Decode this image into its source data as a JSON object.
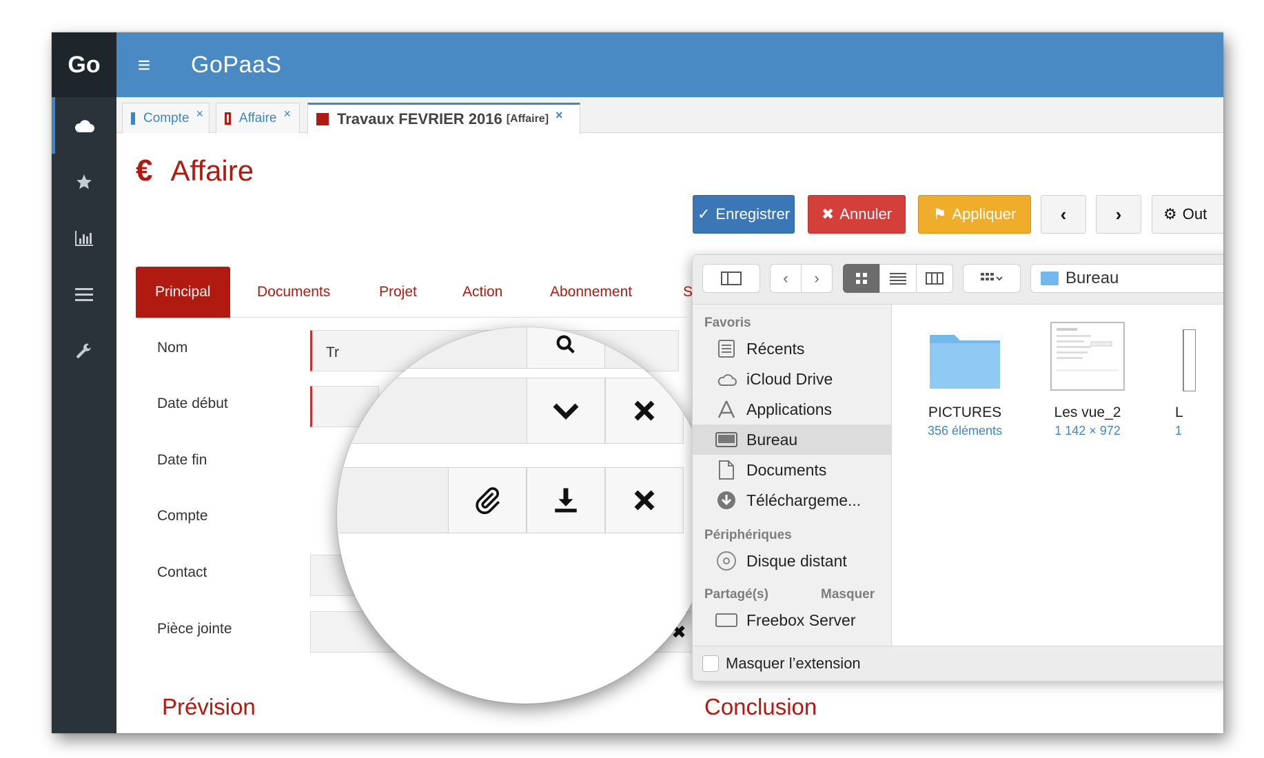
{
  "app": {
    "brand": "Go",
    "title": "GoPaaS",
    "sidebar_icons": [
      "cloud-icon",
      "star-icon",
      "bar-chart-icon",
      "list-icon",
      "wrench-icon"
    ]
  },
  "tabs": [
    {
      "label": "Compte",
      "close": "×"
    },
    {
      "label": "Affaire",
      "close": "×"
    },
    {
      "label": "Travaux FEVRIER 2016",
      "tag": "[Affaire]",
      "close": "×"
    }
  ],
  "page": {
    "euro": "€",
    "title": "Affaire"
  },
  "toolbar": {
    "save": "Enregistrer",
    "cancel": "Annuler",
    "apply": "Appliquer",
    "prev": "‹",
    "next": "›",
    "tools": "Out"
  },
  "form_tabs": [
    "Principal",
    "Documents",
    "Projet",
    "Action",
    "Abonnement",
    "S"
  ],
  "fields": {
    "nom": "Nom",
    "nom_value": "Tr",
    "date_debut": "Date début",
    "date_fin": "Date fin",
    "compte": "Compte",
    "contact": "Contact",
    "piece_jointe": "Pièce jointe"
  },
  "sections": {
    "prevision": "Prévision",
    "conclusion": "Conclusion"
  },
  "finder": {
    "path": "Bureau",
    "favoris_header": "Favoris",
    "favoris": [
      {
        "label": "Récents",
        "icon": "recents-icon"
      },
      {
        "label": "iCloud Drive",
        "icon": "cloud-icon"
      },
      {
        "label": "Applications",
        "icon": "applications-icon"
      },
      {
        "label": "Bureau",
        "icon": "desktop-icon"
      },
      {
        "label": "Documents",
        "icon": "documents-icon"
      },
      {
        "label": "Téléchargeme...",
        "icon": "download-icon"
      }
    ],
    "peripheriques_header": "Périphériques",
    "peripheriques": [
      {
        "label": "Disque distant",
        "icon": "disc-icon"
      }
    ],
    "partages_header": "Partagé(s)",
    "masquer": "Masquer",
    "partages": [
      {
        "label": "Freebox Server",
        "icon": "server-icon"
      }
    ],
    "files": [
      {
        "name": "PICTURES",
        "meta": "356 éléments"
      },
      {
        "name": "Les vue_2",
        "meta": "1 142 × 972"
      },
      {
        "name": "L",
        "meta": "1"
      }
    ],
    "hide_extension": "Masquer l’extension"
  }
}
